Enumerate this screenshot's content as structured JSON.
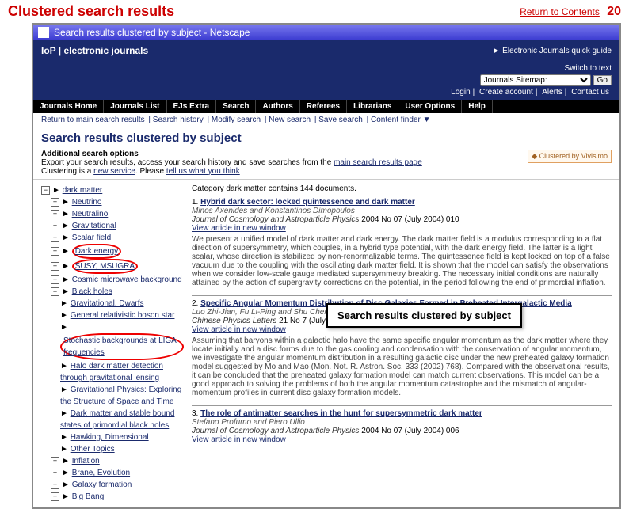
{
  "slide": {
    "title": "Clustered search results",
    "return": "Return to Contents",
    "page": "20"
  },
  "window": {
    "title": "Search results clustered by subject - Netscape"
  },
  "banner": {
    "logo": "IoP | electronic journals",
    "quick": "► Electronic Journals quick guide"
  },
  "ribbon": {
    "switch": "Switch to text",
    "select": "Journals Sitemap:",
    "go": "Go",
    "links": [
      "Login",
      "Create account",
      "Alerts",
      "Contact us"
    ]
  },
  "nav": [
    "Journals Home",
    "Journals List",
    "EJs Extra",
    "Search",
    "Authors",
    "Referees",
    "Librarians",
    "User Options",
    "Help"
  ],
  "subnav": [
    "Return to main search results",
    "Search history",
    "Modify search",
    "New search",
    "Save search",
    "Content finder ▼"
  ],
  "section": "Search results clustered by subject",
  "opts": {
    "h": "Additional search options",
    "l1a": "Export your search results, access your search history and save searches from the ",
    "l1b": "main search results page",
    "l2a": "Clustering is a ",
    "l2b": "new service",
    "l2c": ". Please ",
    "l2d": "tell us what you think",
    "viv": "◆ Clustered by Vivisimo"
  },
  "callout": "Search results clustered by subject",
  "tree": {
    "root": "dark matter",
    "l1": [
      "Neutrino",
      "Neutralino",
      "Gravitational",
      "Scalar field",
      "Dark energy",
      "SUSY, MSUGRA",
      "Cosmic microwave background",
      "Black holes"
    ],
    "bh": [
      "Gravitational, Dwarfs",
      "General relativistic boson star",
      "Stochastic backgrounds at LIGA frequencies",
      "Halo dark matter detection through gravitational lensing",
      "Gravitational Physics: Exploring the Structure of Space and Time",
      "Dark matter and stable bound states of primordial black holes",
      "Hawking, Dimensional",
      "Other Topics"
    ],
    "tail": [
      "Inflation",
      "Brane, Evolution",
      "Galaxy formation",
      "Big Bang"
    ]
  },
  "cat": "Category dark matter contains 144 documents.",
  "res": [
    {
      "n": "1.",
      "t": "Hybrid dark sector: locked quintessence and dark matter",
      "a": "Minos Axenides and Konstantinos Dimopoulos",
      "j": "Journal of Cosmology and Astroparticle Physics",
      "c": "2004 No 07 (July 2004) 010",
      "v": "View article in new window",
      "abs": "We present a unified model of dark matter and dark energy. The dark matter field is a modulus corresponding to a flat direction of supersymmetry, which couples, in a hybrid type potential, with the dark energy field. The latter is a light scalar, whose direction is stabilized by non-renormalizable terms. The quintessence field is kept locked on top of a false vacuum due to the coupling with the oscillating dark matter field. It is shown that the model can satisfy the observations when we consider low-scale gauge mediated supersymmetry breaking. The necessary initial conditions are naturally attained by the action of supergravity corrections on the potential, in the period following the end of primordial inflation."
    },
    {
      "n": "2.",
      "t": "Specific Angular Momentum Distribution of Disc Galaxies Formed in Preheated Intergalactic Media",
      "a": "Luo Zhi-Jian, Fu Li-Ping and Shu Cheng-Gang",
      "j": "Chinese Physics Letters",
      "c": "21 No 7 (July 2004) 1409-1412",
      "v": "View article in new window",
      "abs": "Assuming that baryons within a galactic halo have the same specific angular momentum as the dark matter where they locate initially and a disc forms due to the gas cooling and condensation with the conservation of angular momentum, we investigate the angular momentum distribution in a resulting galactic disc under the new preheated galaxy formation model suggested by Mo and Mao (Mon. Not. R. Astron. Soc. 333 (2002) 768). Compared with the observational results, it can be concluded that the preheated galaxy formation model can match current observations. This model can be a good approach to solving the problems of both the angular momentum catastrophe and the mismatch of angular-momentum profiles in current disc galaxy formation models."
    },
    {
      "n": "3.",
      "t": "The role of antimatter searches in the hunt for supersymmetric dark matter",
      "a": "Stefano Profumo and Piero Ullio",
      "j": "Journal of Cosmology and Astroparticle Physics",
      "c": "2004 No 07 (July 2004) 006",
      "v": "View article in new window",
      "abs": ""
    }
  ]
}
